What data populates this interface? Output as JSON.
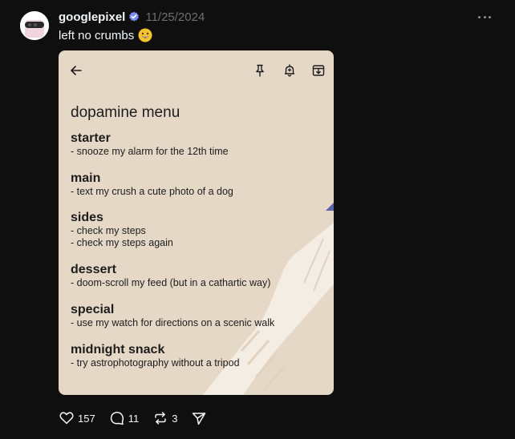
{
  "post": {
    "username": "googlepixel",
    "date": "11/25/2024",
    "caption": "left no crumbs",
    "caption_emoji": "grinning-face-emoji"
  },
  "image": {
    "menu_title": "dopamine menu",
    "sections": [
      {
        "title": "starter",
        "lines": [
          "- snooze my alarm for the 12th time"
        ]
      },
      {
        "title": "main",
        "lines": [
          "- text my crush a cute photo of a dog"
        ]
      },
      {
        "title": "sides",
        "lines": [
          "- check my steps",
          "- check my steps again"
        ]
      },
      {
        "title": "dessert",
        "lines": [
          "- doom-scroll my feed (but in a cathartic way)"
        ]
      },
      {
        "title": "special",
        "lines": [
          "- use my watch for directions on a scenic walk"
        ]
      },
      {
        "title": "midnight snack",
        "lines": [
          "- try astrophotography without a tripod"
        ]
      }
    ],
    "toolbar_icons": [
      "back-arrow-icon",
      "pin-icon",
      "reminder-bell-icon",
      "archive-icon"
    ]
  },
  "actions": {
    "likes": "157",
    "comments": "11",
    "reposts": "3"
  },
  "colors": {
    "background": "#0f0f0f",
    "card": "#e6d8c7",
    "verified": "#7a8cf0",
    "muted_text": "#6f6f6f"
  }
}
